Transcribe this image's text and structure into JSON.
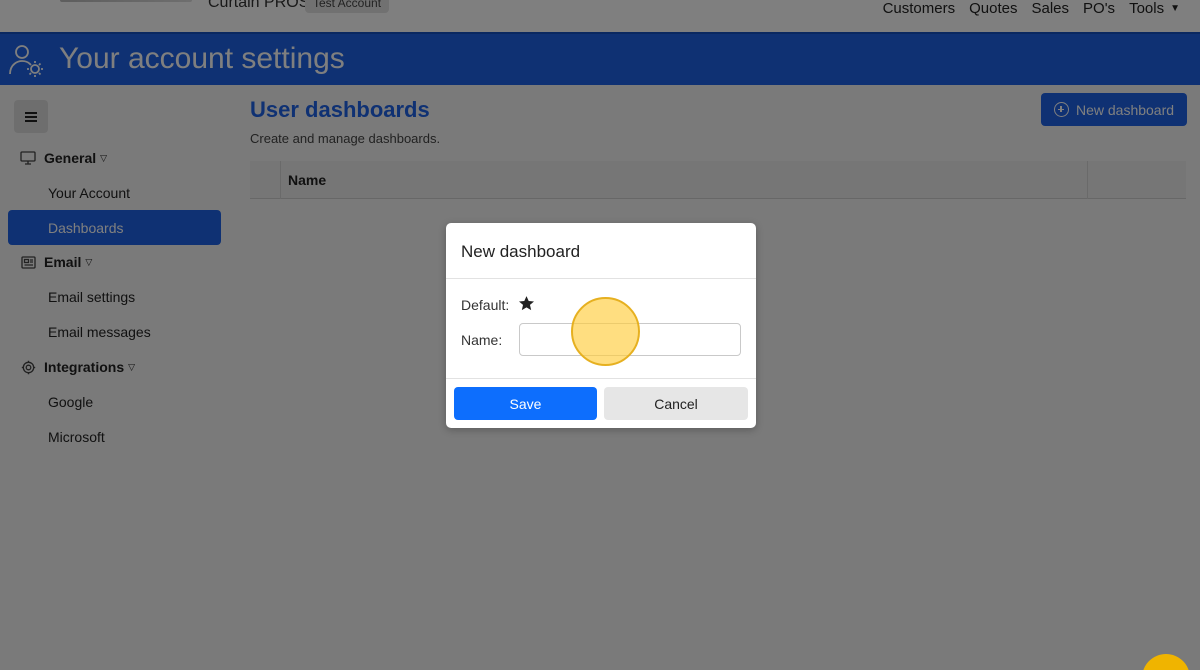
{
  "topnav": {
    "app_name": "Curtain PROS",
    "account_badge": "Test Account",
    "links": [
      "Customers",
      "Quotes",
      "Sales",
      "PO's",
      "Tools"
    ]
  },
  "header": {
    "title": "Your account settings",
    "icon": "user-gear-icon"
  },
  "sidebar": {
    "groups": [
      {
        "label": "General",
        "icon": "monitor-icon",
        "items": [
          "Your Account",
          "Dashboards"
        ]
      },
      {
        "label": "Email",
        "icon": "newspaper-icon",
        "items": [
          "Email settings",
          "Email messages"
        ]
      },
      {
        "label": "Integrations",
        "icon": "gear-icon",
        "items": [
          "Google",
          "Microsoft"
        ]
      }
    ],
    "active_item": "Dashboards"
  },
  "main": {
    "title": "User dashboards",
    "subtitle": "Create and manage dashboards.",
    "new_button": "New dashboard",
    "table_header": {
      "name": "Name"
    }
  },
  "modal": {
    "title": "New dashboard",
    "default_label": "Default:",
    "name_label": "Name:",
    "name_value": "",
    "save_label": "Save",
    "cancel_label": "Cancel"
  },
  "colors": {
    "primary": "#1e63e6",
    "save": "#0d6efd",
    "highlight": "#f0b400"
  }
}
